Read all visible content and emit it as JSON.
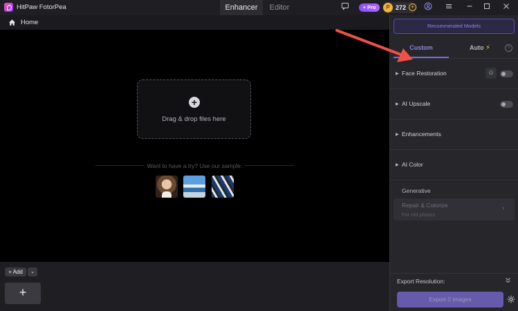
{
  "app": {
    "title": "HitPaw FotorPea"
  },
  "mode_tabs": {
    "enhancer": "Enhancer",
    "editor": "Editor"
  },
  "titlebar": {
    "pro_label": "+ Pro",
    "coin_count": "272",
    "coin_symbol": "P",
    "coin_add": "+"
  },
  "breadcrumb": {
    "home": "Home"
  },
  "dropzone": {
    "plus": "+",
    "label": "Drag & drop files here"
  },
  "samples": {
    "prompt": "Want to have a try? Use our sample.",
    "items": [
      "portrait",
      "landscape",
      "fish"
    ]
  },
  "bottom": {
    "add_label": "+ Add",
    "add_dropdown": "⌄",
    "add_tile": "+"
  },
  "panel": {
    "recommended": "Recommended Models",
    "tabs": {
      "custom": "Custom",
      "auto": "Auto"
    },
    "help": "?",
    "sections": [
      {
        "label": "Face Restoration",
        "toggle": false
      },
      {
        "label": "AI Upscale",
        "toggle": false
      },
      {
        "label": "Enhancements"
      },
      {
        "label": "AI Color"
      }
    ],
    "generative": {
      "label": "Generative",
      "repair_title": "Repair & Colorize",
      "repair_sub": "For old photos"
    },
    "export_label": "Export Resolution:",
    "export_button": "Export 0 images"
  },
  "colors": {
    "accent": "#7b6cf0",
    "annotation_arrow": "#f0504a",
    "coin": "#f0b43a"
  }
}
